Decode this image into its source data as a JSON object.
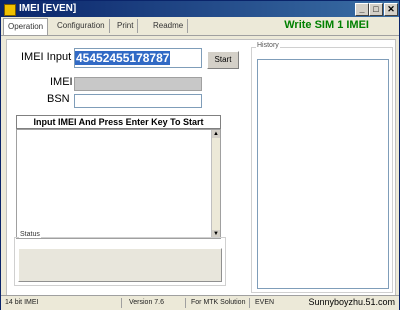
{
  "window": {
    "title": "IMEI  [EVEN]"
  },
  "tabs": [
    {
      "label": "Operation"
    },
    {
      "label": "Configuration"
    },
    {
      "label": "Print"
    },
    {
      "label": "Readme"
    }
  ],
  "header_text": "Write SIM 1 IMEI",
  "form": {
    "imei_input_label": "IMEI Input",
    "imei_input_value": "45452455178787",
    "start_label": "Start",
    "imei_label": "IMEI",
    "bsn_label": "BSN",
    "hint": "Input IMEI And Press Enter Key To Start"
  },
  "status": {
    "label": "Status"
  },
  "history": {
    "label": "History"
  },
  "statusbar": {
    "bits": "14 bit IMEI",
    "version": "Version 7.6",
    "solution": "For MTK Solution",
    "mode": "EVEN",
    "author": "Sunnyboyzhu.51.com"
  }
}
